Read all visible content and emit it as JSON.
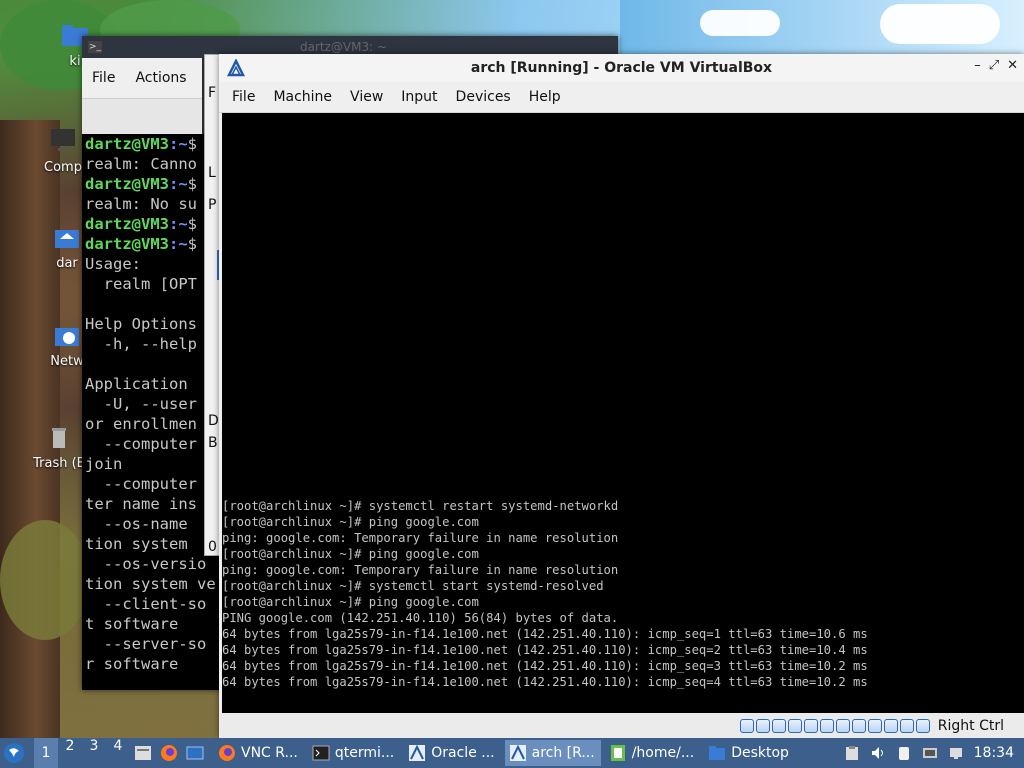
{
  "desktop": {
    "icons": [
      {
        "label": "ki"
      },
      {
        "label": "Comp"
      },
      {
        "label": "dar"
      },
      {
        "label": "Netw"
      },
      {
        "label": "Trash (E"
      }
    ]
  },
  "terminal": {
    "title": "dartz@VM3: ~",
    "menu": {
      "file": "File",
      "actions": "Actions"
    },
    "prompt_user": "dartz@VM3",
    "prompt_dir": ":~",
    "prompt_sign": "$",
    "lines": [
      {
        "kind": "prompt",
        "text": ""
      },
      {
        "kind": "text",
        "text": "realm: Canno"
      },
      {
        "kind": "prompt",
        "text": ""
      },
      {
        "kind": "text",
        "text": "realm: No su"
      },
      {
        "kind": "prompt",
        "text": ""
      },
      {
        "kind": "prompt",
        "text": ""
      },
      {
        "kind": "text",
        "text": "Usage:"
      },
      {
        "kind": "text",
        "text": "  realm [OPT"
      },
      {
        "kind": "text",
        "text": ""
      },
      {
        "kind": "text",
        "text": "Help Options"
      },
      {
        "kind": "text",
        "text": "  -h, --help"
      },
      {
        "kind": "text",
        "text": ""
      },
      {
        "kind": "text",
        "text": "Application "
      },
      {
        "kind": "text",
        "text": "  -U, --user"
      },
      {
        "kind": "text",
        "text": "or enrollmen"
      },
      {
        "kind": "text",
        "text": "  --computer"
      },
      {
        "kind": "text",
        "text": "join"
      },
      {
        "kind": "text",
        "text": "  --computer"
      },
      {
        "kind": "text",
        "text": "ter name ins"
      },
      {
        "kind": "text",
        "text": "  --os-name "
      },
      {
        "kind": "text",
        "text": "tion system "
      },
      {
        "kind": "text",
        "text": "  --os-versio"
      },
      {
        "kind": "text",
        "text": "tion system ve"
      },
      {
        "kind": "text",
        "text": "  --client-so"
      },
      {
        "kind": "text",
        "text": "t software"
      },
      {
        "kind": "text",
        "text": "  --server-so"
      },
      {
        "kind": "text",
        "text": "r software"
      }
    ]
  },
  "middle_window": {
    "menu_fragment": "F",
    "fragments": [
      "L",
      "P",
      "D",
      "B",
      "0"
    ]
  },
  "vbox": {
    "title": "arch [Running] - Oracle VM VirtualBox",
    "menu": [
      "File",
      "Machine",
      "View",
      "Input",
      "Devices",
      "Help"
    ],
    "controls": {
      "minimize": "–",
      "restore": "⤢",
      "close": "✕"
    },
    "console_lines": [
      "[root@archlinux ~]# systemctl restart systemd-networkd",
      "[root@archlinux ~]# ping google.com",
      "ping: google.com: Temporary failure in name resolution",
      "[root@archlinux ~]# ping google.com",
      "ping: google.com: Temporary failure in name resolution",
      "[root@archlinux ~]# systemctl start systemd-resolved",
      "[root@archlinux ~]# ping google.com",
      "PING google.com (142.251.40.110) 56(84) bytes of data.",
      "64 bytes from lga25s79-in-f14.1e100.net (142.251.40.110): icmp_seq=1 ttl=63 time=10.6 ms",
      "64 bytes from lga25s79-in-f14.1e100.net (142.251.40.110): icmp_seq=2 ttl=63 time=10.4 ms",
      "64 bytes from lga25s79-in-f14.1e100.net (142.251.40.110): icmp_seq=3 ttl=63 time=10.2 ms",
      "64 bytes from lga25s79-in-f14.1e100.net (142.251.40.110): icmp_seq=4 ttl=63 time=10.2 ms"
    ],
    "status_icons": [
      "hard-disk-icon",
      "optical-drive-icon",
      "audio-icon",
      "network-icon",
      "usb-icon",
      "shared-folders-icon",
      "display-icon",
      "video-capture-icon",
      "recording-icon",
      "cpu-icon",
      "mouse-integration-icon",
      "keyboard-icon"
    ],
    "host_key": "Right Ctrl"
  },
  "taskbar": {
    "workspaces": [
      "1",
      "2",
      "3",
      "4"
    ],
    "active_workspace": "1",
    "tasks": [
      {
        "label": "VNC R...",
        "icon": "firefox-icon"
      },
      {
        "label": "qtermi...",
        "icon": "terminal-icon"
      },
      {
        "label": "Oracle ...",
        "icon": "virtualbox-icon"
      },
      {
        "label": "arch [R...",
        "icon": "virtualbox-icon"
      },
      {
        "label": "/home/...",
        "icon": "file-manager-icon"
      },
      {
        "label": "Desktop",
        "icon": "folder-icon"
      }
    ],
    "active_task": 3,
    "clock": "18:34"
  },
  "colors": {
    "taskbar": "#3c5f8c",
    "prompt_user": "#5fd75f",
    "prompt_dir": "#6f8fff"
  }
}
